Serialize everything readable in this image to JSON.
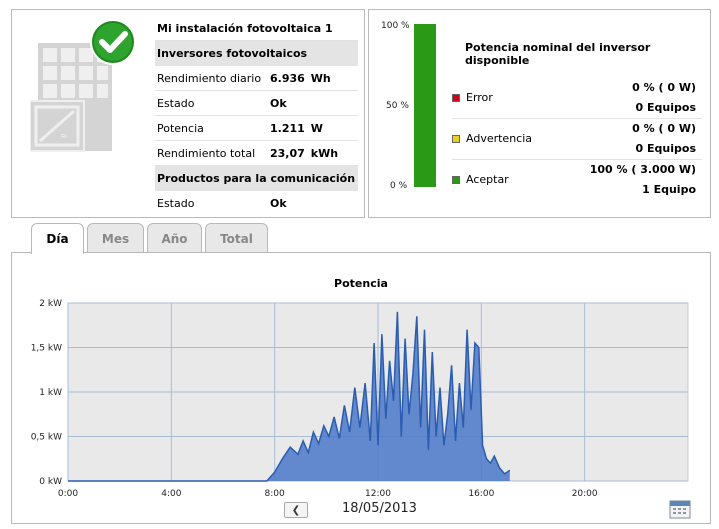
{
  "plant": {
    "name": "Mi instalación fotovoltaica 1",
    "inverters_heading": "Inversores fotovoltaicos",
    "rows": [
      {
        "label": "Rendimiento diario",
        "value": "6.936",
        "unit": "Wh"
      },
      {
        "label": "Estado",
        "value": "Ok",
        "unit": ""
      },
      {
        "label": "Potencia",
        "value": "1.211",
        "unit": "W"
      },
      {
        "label": "Rendimiento total",
        "value": "23,07",
        "unit": "kWh"
      }
    ],
    "comm_heading": "Productos para la comunicación",
    "comm_rows": [
      {
        "label": "Estado",
        "value": "Ok"
      }
    ]
  },
  "power": {
    "title": "Potencia nominal del inversor disponible",
    "scale": [
      "100 %",
      "50 %",
      "0 %"
    ],
    "available_fraction": 1.0,
    "states": [
      {
        "name": "Error",
        "pct": "0 %  ( 0 W)",
        "count": "0 Equipos",
        "color": "#d0021b"
      },
      {
        "name": "Advertencia",
        "pct": "0 %  ( 0 W)",
        "count": "0 Equipos",
        "color": "#e6d21e"
      },
      {
        "name": "Aceptar",
        "pct": "100 %  ( 3.000 W)",
        "count": "1 Equipo",
        "color": "#2a9a16"
      }
    ]
  },
  "tabs": [
    {
      "label": "Día",
      "active": true
    },
    {
      "label": "Mes",
      "active": false
    },
    {
      "label": "Año",
      "active": false
    },
    {
      "label": "Total",
      "active": false
    }
  ],
  "date": "18/05/2013",
  "chart_data": {
    "type": "area",
    "title": "Potencia",
    "xlabel": "",
    "ylabel": "",
    "x_ticks": [
      "0:00",
      "4:00",
      "8:00",
      "12:00",
      "16:00",
      "20:00"
    ],
    "y_ticks": [
      "0 kW",
      "0,5 kW",
      "1 kW",
      "1,5 kW",
      "2 kW"
    ],
    "xlim": [
      0,
      24
    ],
    "ylim": [
      0,
      2
    ],
    "grid": true,
    "color": "#4a78c8",
    "x": [
      0,
      7.7,
      8.0,
      8.3,
      8.6,
      8.9,
      9.1,
      9.3,
      9.5,
      9.7,
      9.9,
      10.1,
      10.3,
      10.5,
      10.7,
      10.9,
      11.1,
      11.3,
      11.5,
      11.7,
      11.85,
      12.0,
      12.15,
      12.3,
      12.45,
      12.6,
      12.75,
      12.9,
      13.05,
      13.2,
      13.35,
      13.5,
      13.65,
      13.8,
      13.95,
      14.1,
      14.25,
      14.4,
      14.55,
      14.7,
      14.85,
      15.0,
      15.15,
      15.3,
      15.45,
      15.6,
      15.75,
      15.9,
      16.05,
      16.2,
      16.35,
      16.5,
      16.7,
      16.9,
      17.1
    ],
    "values": [
      0,
      0,
      0.1,
      0.25,
      0.38,
      0.3,
      0.45,
      0.32,
      0.55,
      0.42,
      0.62,
      0.5,
      0.72,
      0.48,
      0.85,
      0.55,
      1.05,
      0.6,
      1.1,
      0.45,
      1.55,
      0.4,
      1.65,
      0.7,
      1.35,
      0.9,
      1.9,
      0.5,
      1.6,
      0.75,
      1.2,
      1.85,
      0.6,
      1.7,
      0.35,
      1.45,
      0.5,
      1.05,
      0.4,
      0.75,
      1.3,
      0.45,
      1.1,
      0.6,
      1.7,
      0.8,
      1.55,
      1.5,
      0.4,
      0.25,
      0.2,
      0.28,
      0.15,
      0.08,
      0.12
    ]
  }
}
